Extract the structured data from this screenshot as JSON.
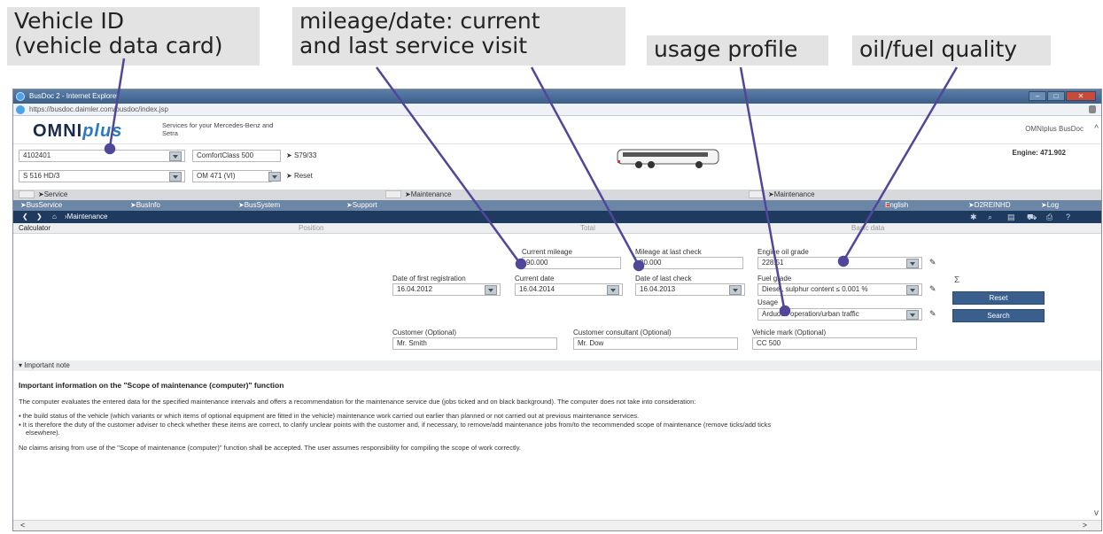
{
  "callouts": {
    "vehicle_id": [
      "Vehicle ID",
      "(vehicle data card)"
    ],
    "mileage_date": [
      "mileage/date: current",
      "and last service visit"
    ],
    "usage_profile": "usage profile",
    "oil_fuel": "oil/fuel quality"
  },
  "browser": {
    "title": "BusDoc 2 - Internet Explorer",
    "url": "https://busdoc.daimler.com/busdoc/index.jsp"
  },
  "header": {
    "logo_main": "OMNI",
    "logo_accent": "plus",
    "tagline": "Services for your Mercedes-Benz and Setra",
    "brand": "OMNIplus BusDoc"
  },
  "vehicle": {
    "id_value": "4102401",
    "model_value": "ComfortClass 500",
    "model_code": "S79/33",
    "variant_value": "S 516 HD/3",
    "engine_select": "OM 471 (VI)",
    "reset_link": "Reset",
    "engine_info": "Engine: 471.902"
  },
  "greybar": {
    "service": "Service",
    "maintenance_1": "Maintenance",
    "maintenance_2": "Maintenance"
  },
  "menu1": {
    "items": [
      "BusService",
      "BusInfo",
      "BusSystem",
      "Support"
    ],
    "language": "English",
    "user": "D2REINHD",
    "logout": "Log out"
  },
  "menu2": {
    "breadcrumb": "Maintenance information"
  },
  "tabs": [
    "Calculator",
    "Position",
    "Total",
    "Basic data"
  ],
  "form": {
    "first_registration_label": "Date of first registration",
    "first_registration_value": "16.04.2012",
    "current_mileage_label": "Current mileage",
    "current_mileage_value": "90.000",
    "current_date_label": "Current date",
    "current_date_value": "16.04.2014",
    "last_mileage_label": "Mileage at last check",
    "last_mileage_value": "30.000",
    "last_date_label": "Date of last check",
    "last_date_value": "16.04.2013",
    "oil_grade_label": "Engine oil grade",
    "oil_grade_value": "228.51",
    "fuel_grade_label": "Fuel grade",
    "fuel_grade_value": "Diesel, sulphur content ≤ 0.001 %",
    "usage_label": "Usage",
    "usage_value": "Arduous operation/urban traffic",
    "reset_button": "Reset",
    "search_button": "Search",
    "customer_label": "Customer (Optional)",
    "customer_value": "Mr. Smith",
    "consultant_label": "Customer consultant (Optional)",
    "consultant_value": "Mr. Dow",
    "vehicle_mark_label": "Vehicle mark (Optional)",
    "vehicle_mark_value": "CC 500",
    "sum_icon": "Σ"
  },
  "note": {
    "bar_label": "Important note",
    "title": "Important information on the \"Scope of maintenance (computer)\" function",
    "p1": "The computer evaluates the entered data for the specified maintenance intervals and offers a recommendation for the maintenance service due (jobs ticked and on black background). The computer does not take into consideration:",
    "li1": "the build status of the vehicle (which variants or which items of optional equipment are fitted in the vehicle) maintenance work carried out earlier than planned or not carried out at previous maintenance services.",
    "li2a": "It is therefore the duty of the customer adviser to check whether these items are correct, to clarify unclear points with the customer and, if necessary, to remove/add maintenance jobs from/to the recommended scope of maintenance (remove ticks/add ticks",
    "li2b": "elsewhere).",
    "p2": "No claims arising from use of the \"Scope of maintenance (computer)\" function shall be accepted. The user assumes responsibility for compiling the scope of work correctly."
  },
  "colors": {
    "menu_blue": "#6c87a6",
    "nav_dark": "#1f3a5f",
    "button_blue": "#3a5f8d",
    "callout_bg": "#e3e3e3"
  }
}
